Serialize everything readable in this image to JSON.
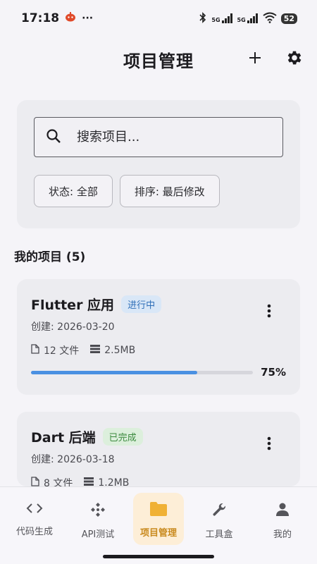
{
  "status_bar": {
    "time": "17:18",
    "battery": "52",
    "net1": "5G",
    "net2": "5G",
    "icons": [
      "notification-app-icon",
      "more-dots-icon",
      "bluetooth-icon",
      "signal-icon",
      "signal-icon",
      "wifi-icon",
      "battery-icon"
    ]
  },
  "header": {
    "title": "项目管理",
    "add_icon": "plus-icon",
    "settings_icon": "gear-icon"
  },
  "search": {
    "placeholder": "搜索项目..."
  },
  "filters": {
    "status_label": "状态: 全部",
    "sort_label": "排序: 最后修改"
  },
  "projects_section": {
    "title": "我的项目 (5)"
  },
  "projects": [
    {
      "name": "Flutter 应用",
      "status": "进行中",
      "status_color": "#2f6fb8",
      "status_bg": "#d9e7f7",
      "created": "创建: 2026-03-20",
      "files": "12 文件",
      "size": "2.5MB",
      "progress": 0.75,
      "progress_label": "75%"
    },
    {
      "name": "Dart 后端",
      "status": "已完成",
      "status_color": "#3b8a3e",
      "status_bg": "#dcefdc",
      "created": "创建: 2026-03-18",
      "files": "8 文件",
      "size": "1.2MB"
    }
  ],
  "bottom_nav": {
    "items": [
      {
        "label": "代码生成",
        "icon": "code-icon"
      },
      {
        "label": "API测试",
        "icon": "api-icon"
      },
      {
        "label": "项目管理",
        "icon": "folder-icon",
        "active": true
      },
      {
        "label": "工具盒",
        "icon": "wrench-icon"
      },
      {
        "label": "我的",
        "icon": "person-icon"
      }
    ]
  },
  "colors": {
    "accent": "#f0b135",
    "progress": "#4a90e2"
  }
}
